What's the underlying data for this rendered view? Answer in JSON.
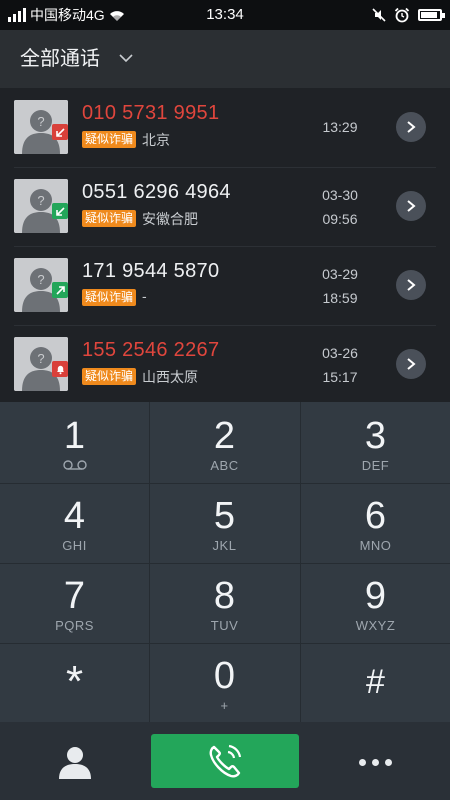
{
  "status": {
    "carrier": "中国移动4G",
    "time": "13:34",
    "battery_percent": 90
  },
  "header": {
    "title": "全部通话"
  },
  "calls": [
    {
      "number": "010 5731 9951",
      "number_color": "red",
      "tag": "疑似诈骗",
      "location": "北京",
      "date": "",
      "time": "13:29",
      "type": "missed",
      "badge_color": "#d9403a"
    },
    {
      "number": "0551 6296 4964",
      "number_color": "white",
      "tag": "疑似诈骗",
      "location": "安徽合肥",
      "date": "03-30",
      "time": "09:56",
      "type": "incoming",
      "badge_color": "#23a65a"
    },
    {
      "number": "171 9544 5870",
      "number_color": "white",
      "tag": "疑似诈骗",
      "location": "-",
      "date": "03-29",
      "time": "18:59",
      "type": "outgoing",
      "badge_color": "#23a65a"
    },
    {
      "number": "155 2546 2267",
      "number_color": "red",
      "tag": "疑似诈骗",
      "location": "山西太原",
      "date": "03-26",
      "time": "15:17",
      "type": "blocked",
      "badge_color": "#d9403a"
    }
  ],
  "keypad": [
    {
      "digit": "1",
      "letters": "",
      "extra": "voicemail-icon"
    },
    {
      "digit": "2",
      "letters": "ABC"
    },
    {
      "digit": "3",
      "letters": "DEF"
    },
    {
      "digit": "4",
      "letters": "GHI"
    },
    {
      "digit": "5",
      "letters": "JKL"
    },
    {
      "digit": "6",
      "letters": "MNO"
    },
    {
      "digit": "7",
      "letters": "PQRS"
    },
    {
      "digit": "8",
      "letters": "TUV"
    },
    {
      "digit": "9",
      "letters": "WXYZ"
    },
    {
      "digit": "*",
      "letters": ""
    },
    {
      "digit": "0",
      "letters": "+"
    },
    {
      "digit": "#",
      "letters": ""
    }
  ],
  "colors": {
    "accent_green": "#23a65a",
    "missed_red": "#e0463d",
    "tag_orange": "#ef8a1d"
  }
}
